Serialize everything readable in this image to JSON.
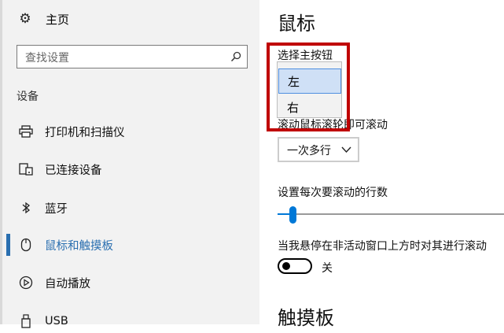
{
  "sidebar": {
    "home_label": "主页",
    "search_placeholder": "查找设置",
    "section_label": "设备",
    "items": [
      {
        "label": "打印机和扫描仪",
        "icon": "printer-icon"
      },
      {
        "label": "已连接设备",
        "icon": "connected-devices-icon"
      },
      {
        "label": "蓝牙",
        "icon": "bluetooth-icon"
      },
      {
        "label": "鼠标和触摸板",
        "icon": "mouse-icon",
        "active": true
      },
      {
        "label": "自动播放",
        "icon": "autoplay-icon"
      },
      {
        "label": "USB",
        "icon": "usb-icon"
      }
    ]
  },
  "main": {
    "title": "鼠标",
    "primary_button_label": "选择主按钮",
    "primary_button_options": [
      "左",
      "右"
    ],
    "primary_button_selected": "左",
    "wheel_label": "滚动鼠标滚轮即可滚动",
    "wheel_value": "一次多行",
    "lines_label": "设置每次要滚动的行数",
    "lines_slider_level_fraction": 0.06,
    "hover_scroll_label": "当我悬停在非活动窗口上方时对其进行滚动",
    "hover_scroll_state": "关",
    "touchpad_title": "触摸板"
  },
  "colors": {
    "accent": "#0078d7",
    "active_nav": "#2a6fb0",
    "highlight_box": "#c00000",
    "sidebar_bg": "#f2f2f2"
  }
}
